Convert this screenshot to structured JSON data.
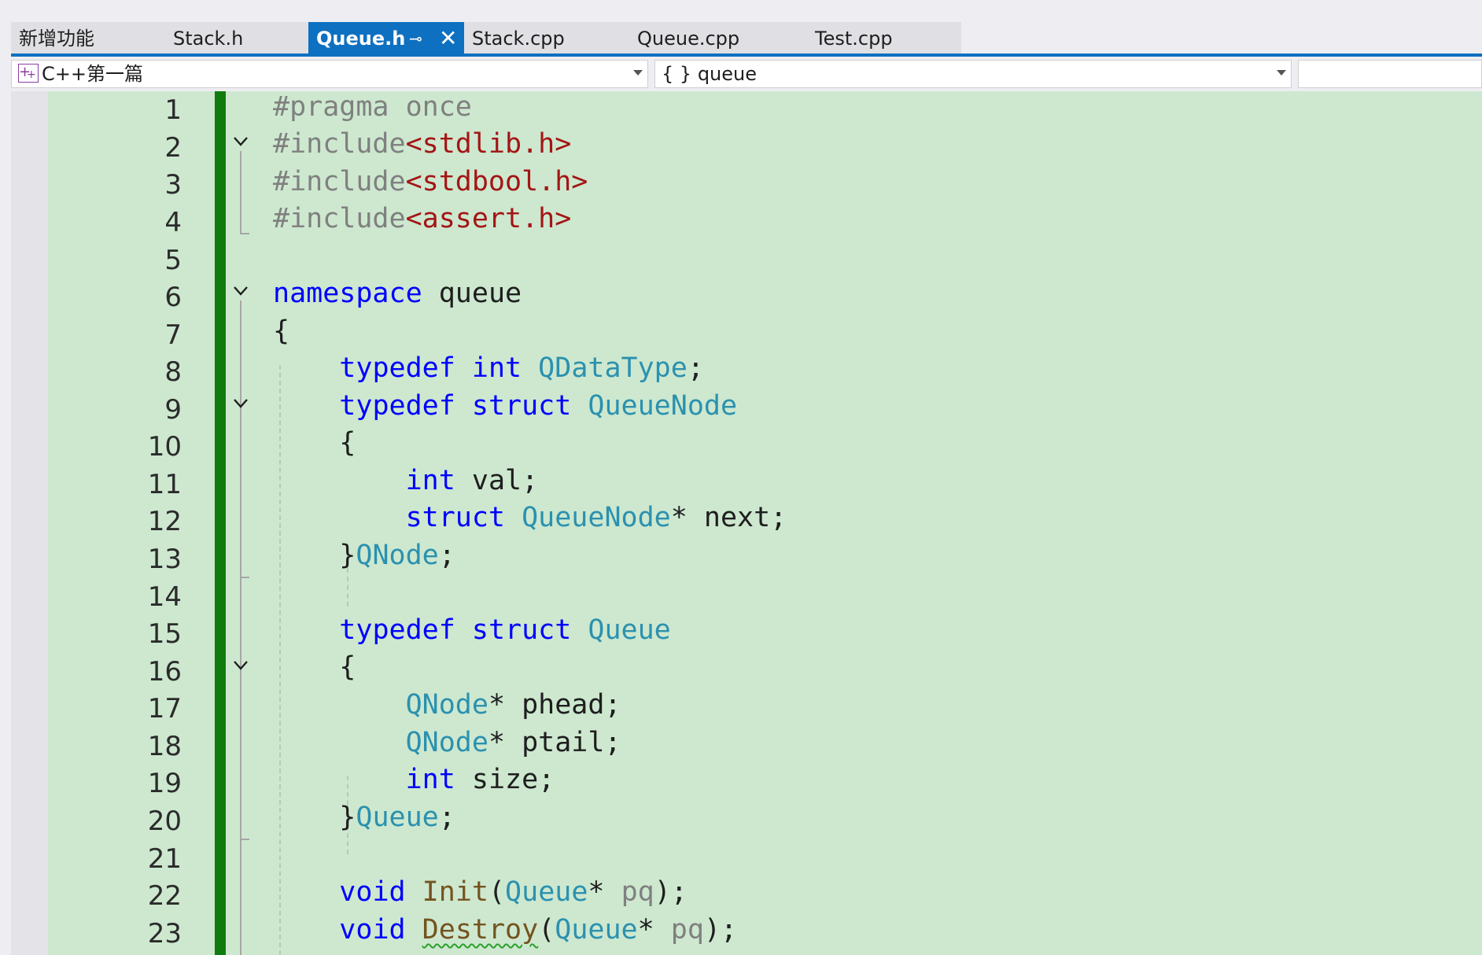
{
  "tabs": [
    {
      "label": "新增功能",
      "active": false
    },
    {
      "label": "Stack.h",
      "active": false
    },
    {
      "label": "Queue.h",
      "active": true
    },
    {
      "label": "Stack.cpp",
      "active": false
    },
    {
      "label": "Queue.cpp",
      "active": false
    },
    {
      "label": "Test.cpp",
      "active": false
    }
  ],
  "tab_pin_glyph": "⊸",
  "tab_close_glyph": "✕",
  "navbar": {
    "project": "C++第一篇",
    "scope": "queue",
    "scope_icon": "{ }",
    "member": ""
  },
  "colors": {
    "accent": "#0e70c0",
    "editor_bg": "#cde8cf",
    "change_bar": "#107c10",
    "keyword": "#0000ff",
    "type": "#2b91af",
    "string": "#a31515",
    "preprocessor": "#808080",
    "function": "#74531f"
  },
  "icons": [
    "solution-project-icon",
    "namespace-braces-icon",
    "pin-icon",
    "close-icon",
    "collapse-chevron-icon"
  ],
  "editor": {
    "line_numbers": [
      "1",
      "2",
      "3",
      "4",
      "5",
      "6",
      "7",
      "8",
      "9",
      "10",
      "11",
      "12",
      "13",
      "14",
      "15",
      "16",
      "17",
      "18",
      "19",
      "20",
      "21",
      "22",
      "23"
    ],
    "lines": {
      "l1": {
        "pp": "#pragma once"
      },
      "l2": {
        "pp": "#include",
        "str": "<stdlib.h>"
      },
      "l3": {
        "pp": "#include",
        "str": "<stdbool.h>"
      },
      "l4": {
        "pp": "#include",
        "str": "<assert.h>"
      },
      "l6": {
        "kw": "namespace",
        "name": " queue"
      },
      "l7": {
        "text": "{"
      },
      "l8": {
        "indent": "    ",
        "kw1": "typedef",
        "kw2": " int",
        "type": " QDataType",
        "end": ";"
      },
      "l9": {
        "indent": "    ",
        "kw1": "typedef",
        "kw2": " struct",
        "type": " QueueNode"
      },
      "l10": {
        "text": "    {"
      },
      "l11": {
        "indent": "        ",
        "kw": "int",
        "rest": " val;"
      },
      "l12": {
        "indent": "        ",
        "kw": "struct",
        "type": " QueueNode",
        "rest": "* next;"
      },
      "l13": {
        "indent": "    ",
        "brace": "}",
        "type": "QNode",
        "end": ";"
      },
      "l15": {
        "indent": "    ",
        "kw1": "typedef",
        "kw2": " struct",
        "type": " Queue"
      },
      "l16": {
        "text": "    {"
      },
      "l17": {
        "indent": "        ",
        "type": "QNode",
        "rest": "* phead;"
      },
      "l18": {
        "indent": "        ",
        "type": "QNode",
        "rest": "* ptail;"
      },
      "l19": {
        "indent": "        ",
        "kw": "int",
        "rest": " size;"
      },
      "l20": {
        "indent": "    ",
        "brace": "}",
        "type": "Queue",
        "end": ";"
      },
      "l22": {
        "indent": "    ",
        "kw": "void",
        "sp": " ",
        "fn": "Init",
        "open": "(",
        "type": "Queue",
        "star": "* ",
        "param": "pq",
        "close": ");"
      },
      "l23": {
        "indent": "    ",
        "kw": "void",
        "sp": " ",
        "fn": "Destroy",
        "open": "(",
        "type": "Queue",
        "star": "* ",
        "param": "pq",
        "close": ");"
      }
    }
  }
}
